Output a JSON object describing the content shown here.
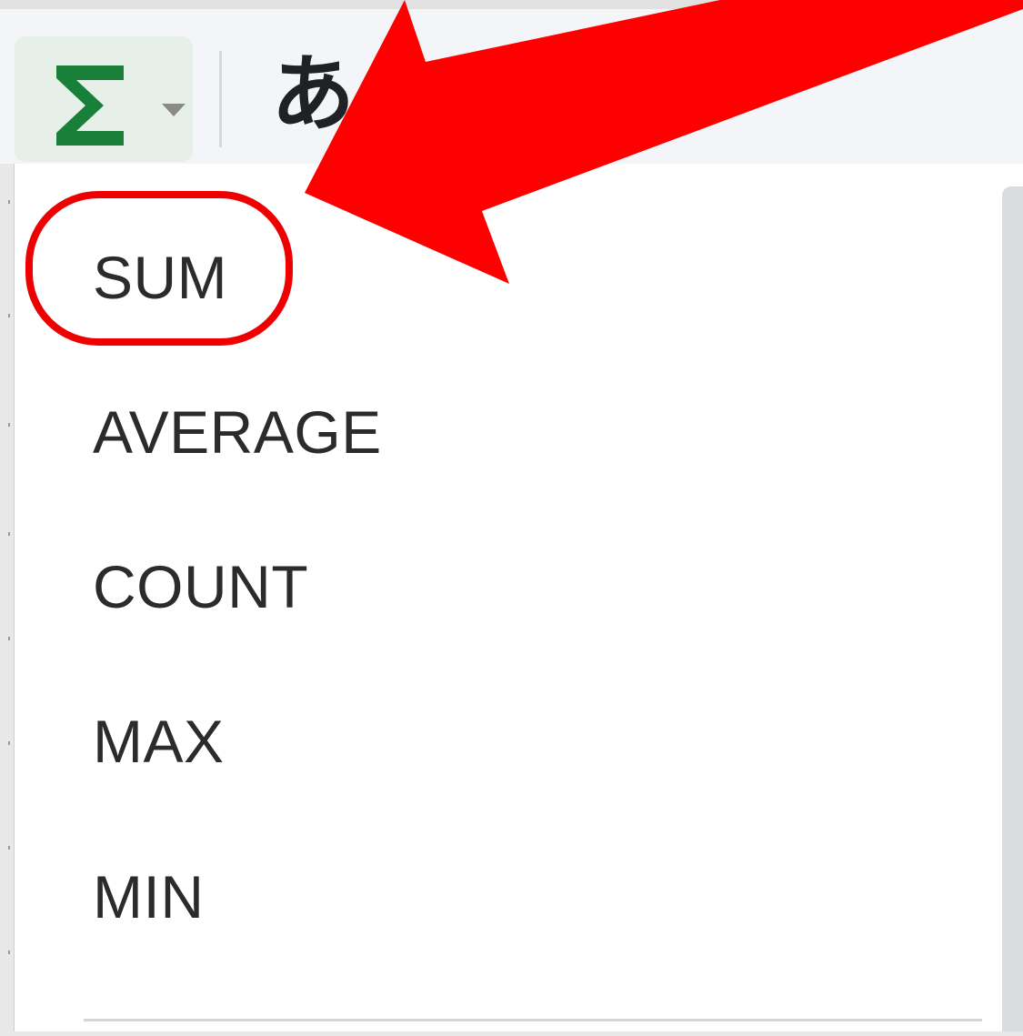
{
  "toolbar": {
    "function_icon": "sigma-icon",
    "dropdown_icon": "caret-down-icon",
    "input_tools_label": "あ",
    "accent_color": "#188038"
  },
  "menu": {
    "items": [
      {
        "label": "SUM"
      },
      {
        "label": "AVERAGE"
      },
      {
        "label": "COUNT"
      },
      {
        "label": "MAX"
      },
      {
        "label": "MIN"
      }
    ]
  },
  "annotation": {
    "highlighted_item": "SUM",
    "arrow_icon": "arrow-pointing-icon",
    "color": "#ff0000"
  }
}
